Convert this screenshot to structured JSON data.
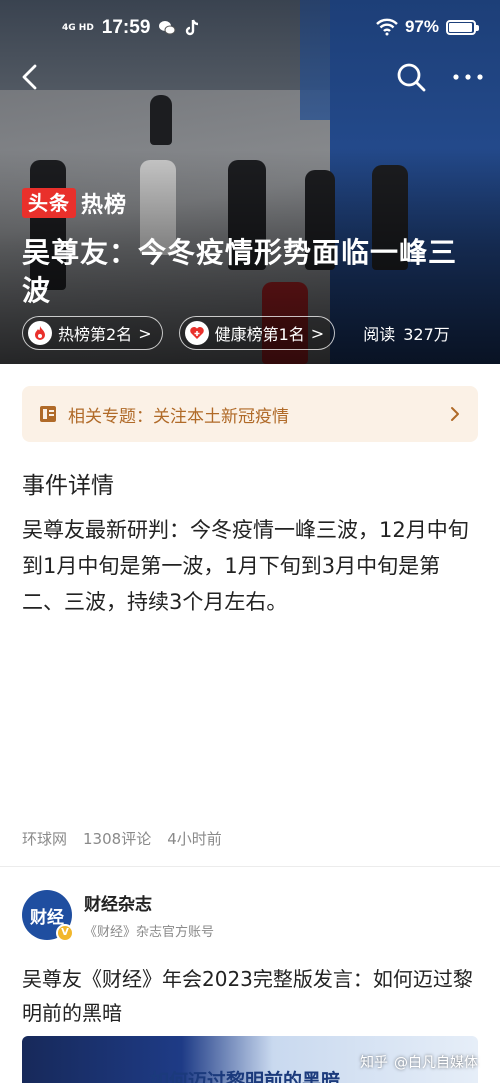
{
  "status_bar": {
    "network": "4G HD",
    "time": "17:59",
    "battery": "97%",
    "battery_level": 0.97
  },
  "header": {
    "back_icon": "chevron-left-icon",
    "search_icon": "search-icon",
    "more_icon": "more-dots-icon"
  },
  "hero": {
    "logo_red": "头条",
    "logo_white": "热榜",
    "title": "吴尊友：今冬疫情形势面临一峰三波",
    "tags": [
      {
        "label": "热榜第2名",
        "arrow": ">",
        "icon": "flame-icon"
      },
      {
        "label": "健康榜第1名",
        "arrow": ">",
        "icon": "heart-icon"
      }
    ],
    "reads_label": "阅读",
    "reads_value": "327万"
  },
  "topic": {
    "label": "相关专题：关注本土新冠疫情",
    "icon": "document-icon",
    "color": "#b06a28"
  },
  "event": {
    "section_title": "事件详情",
    "body": "吴尊友最新研判：今冬疫情一峰三波，12月中旬到1月中旬是第一波，1月下旬到3月中旬是第二、三波，持续3个月左右。"
  },
  "meta": {
    "source": "环球网",
    "comments": "1308评论",
    "time_ago": "4小时前"
  },
  "article": {
    "author_avatar_text": "财经",
    "verified_badge": "V",
    "author_name": "财经杂志",
    "author_desc": "《财经》杂志官方账号",
    "title": "吴尊友《财经》年会2023完整版发言：如何迈过黎明前的黑暗",
    "thumb_text": "如何迈过黎明前的黑暗"
  },
  "watermark": {
    "site": "知乎",
    "user": "@白凡自媒体"
  },
  "colors": {
    "accent_red": "#e9302b",
    "topic_bg": "#fbf1e6",
    "avatar_blue": "#1f4ea0"
  }
}
